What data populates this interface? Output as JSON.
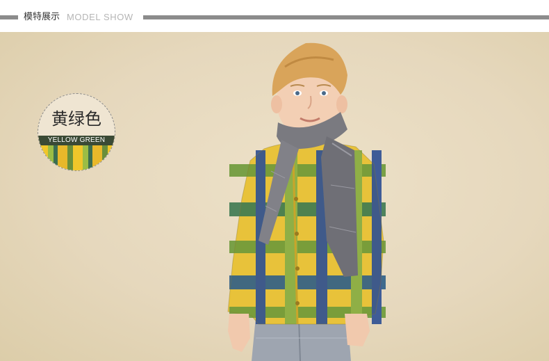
{
  "header": {
    "title_cn": "模特展示",
    "title_en": "MODEL SHOW"
  },
  "color_badge": {
    "name": "黄绿色",
    "code": "YELLOW GREEN"
  },
  "photo": {
    "subject": "boy-model-plaid-shirt-scarf"
  }
}
